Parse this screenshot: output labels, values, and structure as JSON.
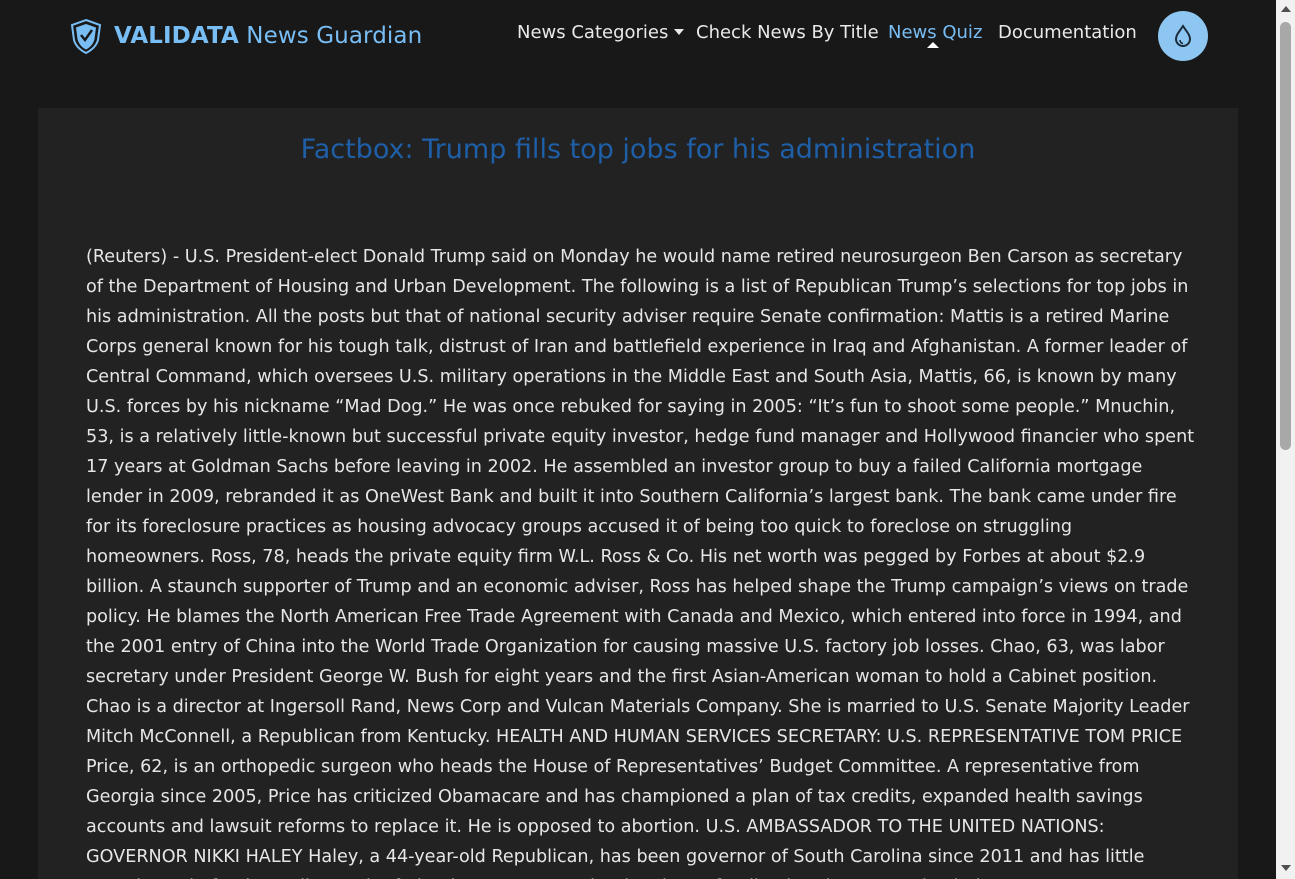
{
  "brand": {
    "name_bold": "VALIDATA",
    "name_rest": " News Guardian",
    "icon": "shield-icon"
  },
  "nav": {
    "categories_label": "News Categories",
    "check_label": "Check News By Title",
    "quiz_label": "News Quiz",
    "docs_label": "Documentation",
    "theme_icon": "water-drop-icon"
  },
  "article": {
    "title": "Factbox: Trump fills top jobs for his administration",
    "body": "(Reuters) - U.S. President-elect Donald Trump said on Monday he would name retired neurosurgeon Ben Carson as secretary of the Department of Housing and Urban Development. The following is a list of Republican Trump’s selections for top jobs in his administration. All the posts but that of national security adviser require Senate confirmation: Mattis is a retired Marine Corps general known for his tough talk, distrust of Iran and battlefield experience in Iraq and Afghanistan. A former leader of Central Command, which oversees U.S. military operations in the Middle East and South Asia, Mattis, 66, is known by many U.S. forces by his nickname “Mad Dog.” He was once rebuked for saying in 2005: “It’s fun to shoot some people.” Mnuchin, 53, is a relatively little-known but successful private equity investor, hedge fund manager and Hollywood financier who spent 17 years at Goldman Sachs before leaving in 2002. He assembled an investor group to buy a failed California mortgage lender in 2009, rebranded it as OneWest Bank and built it into Southern California’s largest bank. The bank came under fire for its foreclosure practices as housing advocacy groups accused it of being too quick to foreclose on struggling homeowners. Ross, 78, heads the private equity firm W.L. Ross & Co. His net worth was pegged by Forbes at about $2.9 billion. A staunch supporter of Trump and an economic adviser, Ross has helped shape the Trump campaign’s views on trade policy. He blames the North American Free Trade Agreement with Canada and Mexico, which entered into force in 1994, and the 2001 entry of China into the World Trade Organization for causing massive U.S. factory job losses. Chao, 63, was labor secretary under President George W. Bush for eight years and the first Asian-American woman to hold a Cabinet position. Chao is a director at Ingersoll Rand, News Corp and Vulcan Materials Company. She is married to U.S. Senate Majority Leader Mitch McConnell, a Republican from Kentucky. HEALTH AND HUMAN SERVICES SECRETARY: U.S. REPRESENTATIVE TOM PRICE Price, 62, is an orthopedic surgeon who heads the House of Representatives’ Budget Committee. A representative from Georgia since 2005, Price has criticized Obamacare and has championed a plan of tax credits, expanded health savings accounts and lawsuit reforms to replace it. He is opposed to abortion. U.S. AMBASSADOR TO THE UNITED NATIONS: GOVERNOR NIKKI HALEY Haley, a 44-year-old Republican, has been governor of South Carolina since 2011 and has little experience in foreign policy or the federal government. The daughter of Indian immigrants, Haley led a"
  },
  "colors": {
    "background": "#181818",
    "card": "#222222",
    "accent": "#78bef5",
    "title": "#1e5fa8",
    "theme_button": "#8ec6f2"
  }
}
